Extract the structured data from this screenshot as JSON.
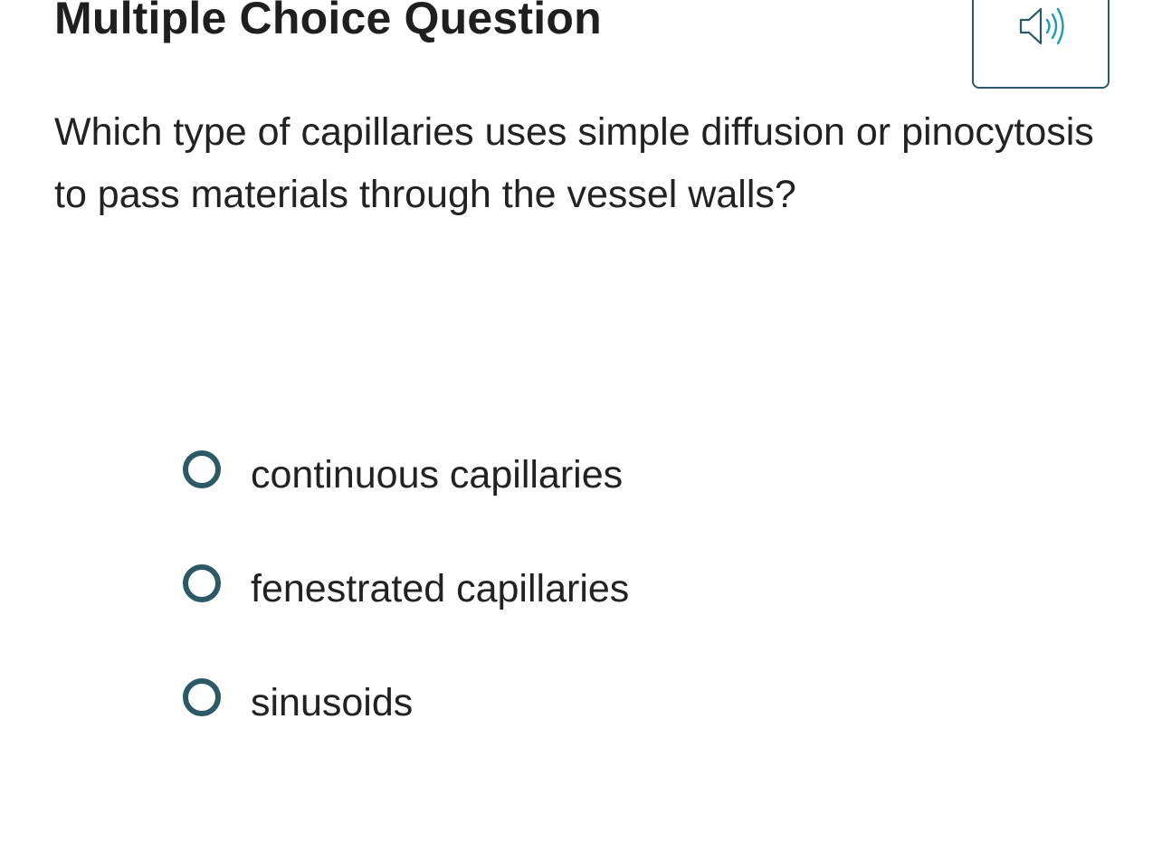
{
  "header": {
    "title": "Multiple Choice Question",
    "audio_icon": "speaker-icon"
  },
  "question": {
    "text": "Which type of capillaries uses simple diffusion or pinocytosis to pass materials through the vessel walls?"
  },
  "options": [
    {
      "label": "continuous capillaries",
      "selected": false
    },
    {
      "label": "fenestrated capillaries",
      "selected": false
    },
    {
      "label": "sinusoids",
      "selected": false
    }
  ],
  "colors": {
    "accent": "#2b5a66",
    "speaker_waves": "#1a9db5",
    "text": "#222222"
  }
}
